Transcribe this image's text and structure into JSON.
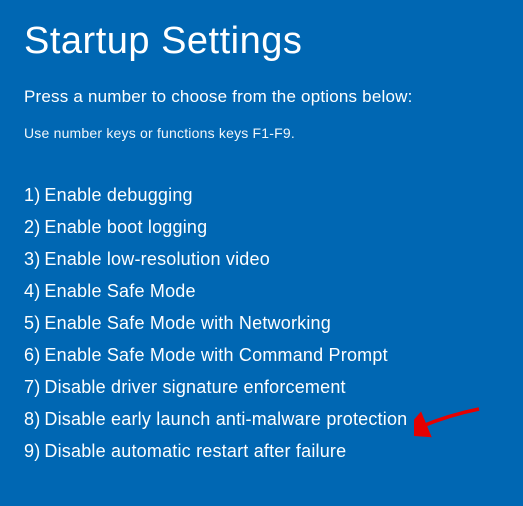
{
  "title": "Startup Settings",
  "subtitle": "Press a number to choose from the options below:",
  "hint": "Use number keys or functions keys F1-F9.",
  "options": [
    {
      "number": "1)",
      "label": "Enable debugging"
    },
    {
      "number": "2)",
      "label": "Enable boot logging"
    },
    {
      "number": "3)",
      "label": "Enable low-resolution video"
    },
    {
      "number": "4)",
      "label": "Enable Safe Mode"
    },
    {
      "number": "5)",
      "label": "Enable Safe Mode with Networking"
    },
    {
      "number": "6)",
      "label": "Enable Safe Mode with Command Prompt"
    },
    {
      "number": "7)",
      "label": "Disable driver signature enforcement"
    },
    {
      "number": "8)",
      "label": "Disable early launch anti-malware protection"
    },
    {
      "number": "9)",
      "label": "Disable automatic restart after failure"
    }
  ],
  "annotation": {
    "type": "arrow",
    "target_option_index": 6,
    "color": "#e60000"
  }
}
